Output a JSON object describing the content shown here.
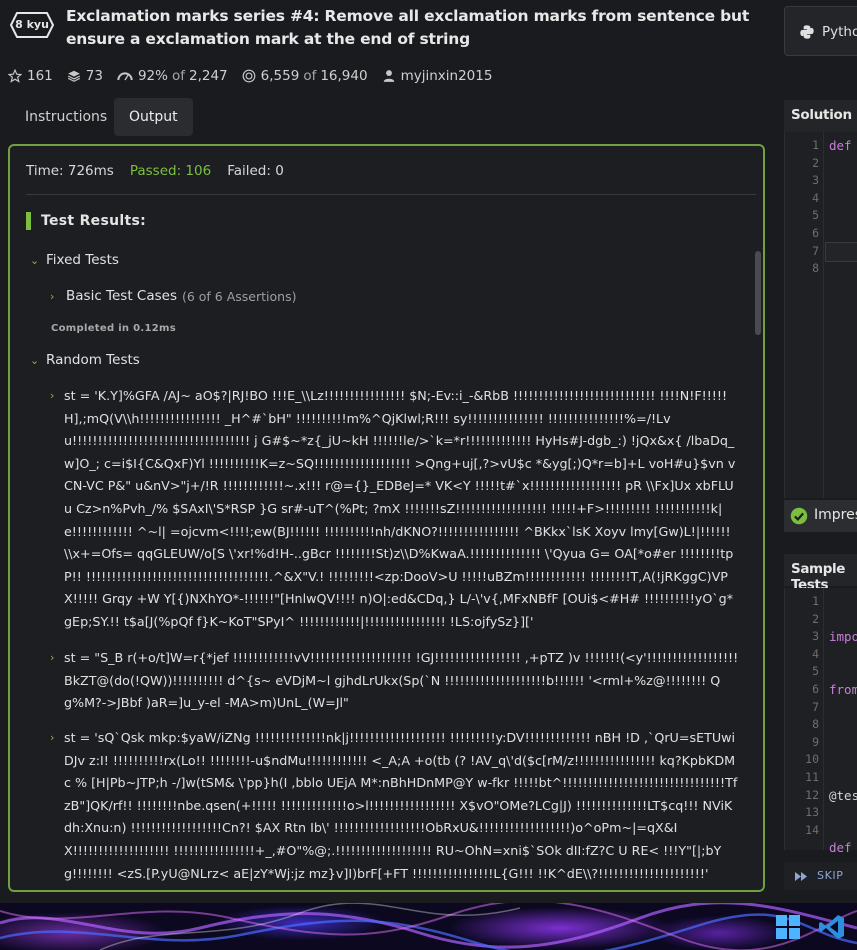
{
  "kata": {
    "rank": "8 kyu",
    "title": "Exclamation marks series #4: Remove all exclamation marks from sentence but ensure a exclamation mark at the end of string"
  },
  "stats": {
    "stars": "161",
    "collections": "73",
    "satisfaction": "92%",
    "of_word": "of",
    "votes": "2,247",
    "completed": "6,559",
    "attempts": "16,940",
    "author": "myjinxin2015"
  },
  "tabs": {
    "instructions": "Instructions",
    "output": "Output"
  },
  "output": {
    "time": "Time: 726ms",
    "passed": "Passed: 106",
    "failed": "Failed: 0",
    "test_results": "Test Results:",
    "fixed_tests": "Fixed Tests",
    "basic_cases": "Basic Test Cases",
    "basic_assertions": "(6 of 6 Assertions)",
    "completed": "Completed in 0.12ms",
    "random_tests": "Random Tests",
    "cases": [
      "st = 'K.Y]%GFA /AJ~ aO$?|RJ!BO !!!E_\\\\Lz!!!!!!!!!!!!!!!! $N;-Ev::i_-&RbB !!!!!!!!!!!!!!!!!!!!!!!!!!!! !!!!N!F!!!!!H],;mQ(V\\\\h!!!!!!!!!!!!!!!! _H^#`bH\" !!!!!!!!!!m%^QjKlwl;R!!! sy!!!!!!!!!!!!!!! !!!!!!!!!!!!!!!%=/!Lvu!!!!!!!!!!!!!!!!!!!!!!!!!!!!!!!!!!! j G#$~*z{_jU~kH !!!!!!le/>`k=*r!!!!!!!!!!!!! HyHs#J-dgb_:) !jQx&x{ /lbaDq_w]O_; c=i$I{C&QxF)Yl !!!!!!!!!!K=z~SQ!!!!!!!!!!!!!!!!!!! >Qng+uj[,?>vU$c *&yg[;)Q*r=b]+L voH#u}$vn vCN-VC P&\" u&nV>\"j+/!R !!!!!!!!!!!!~.x!!! r@={}_EDBeJ=* VK<Y !!!!!t#`x!!!!!!!!!!!!!!!!!! pR \\\\Fx]Ux xbFLUu Cz>n%Pvh_/% $SAxI\\'S*RSP }G sr#-uT^(%Pt; ?mX !!!!!!!sZ!!!!!!!!!!!!!!!!!!  !!!!!+F>!!!!!!!!! !!!!!!!!!!!k|e!!!!!!!!!!!! ^~l| =ojcvm<!!!!;ew(BJ!!!!!! !!!!!!!!!!nh/dKNO?!!!!!!!!!!!!!!!! ^BKkx`lsK Xoyv lmy[Gw)L!|!!!!!! \\\\x+=Ofs= qqGLEUW/o[S \\'xr!%d!H-..gBcr !!!!!!!!St)z\\\\D%KwaA.!!!!!!!!!!!!!! \\'Qyua G= OA[*o#er !!!!!!!!tpP!! !!!!!!!!!!!!!!!!!!!!!!!!!!!!!!!!!!!!.^&X\"V.! !!!!!!!!!<zp:DooV>U !!!!!uBZm!!!!!!!!!!!! !!!!!!!!T,A(!jRKggC)VPX!!!!! Grqy  +W Y[{)NXhYO*-!!!!!!\"[HnlwQV!!!! n)O|:ed&CDq,}  L/-\\'v{,MFxNBfF [OUi$<#H# !!!!!!!!!!yO`g*gEp;SY.!! t$a[J(%pQf f}K~KoT\"SPyI^ !!!!!!!!!!!!|!!!!!!!!!!!!!!!! !LS:ojfySz}]['",
      "st = \"S_B r(+o/t]W=r{*jef !!!!!!!!!!!!vV!!!!!!!!!!!!!!!!!!!! !GJ!!!!!!!!!!!!!!!!! ,+pTZ  )v !!!!!!!(<y'!!!!!!!!!!!!!!!!!!BkZT@(do(!QW))!!!!!!!!!! d^{s~ eVDjM~l gjhdLrUkx(Sp(`N !!!!!!!!!!!!!!!!!!!!b!!!!!! '<rml+%z@!!!!!!!! Qg%M?->JBbf )aR=]u_y-el -MA>m)UnL_(W=Jl\"",
      "st = 'sQ`Qsk mkp:$yaW/iZNg !!!!!!!!!!!!!!nk|j!!!!!!!!!!!!!!!!!!! !!!!!!!!!y:DV!!!!!!!!!!!!! nBH !D  ,`QrU=sETUwiDJv z:I! !!!!!!!!!!rx(Lo!! !!!!!!!!-u$ndMu!!!!!!!!!!!! <_A;A +o(tb (? !AV_q\\'d($c[rM/z!!!!!!!!!!!!!!!! kq?KpbKDMc % [H|Pb~JTP;h -/]w(tSM& \\'pp}h(I ,bblo UEjA M*:nBhHDnMP@Y w-fkr !!!!!bt^!!!!!!!!!!!!!!!!!!!!!!!!!!!!!!!!TfzB\"]QK/rf!! !!!!!!!!nbe.qsen(+!!!!! !!!!!!!!!!!!!o>l!!!!!!!!!!!!!!!!! X$vO\"OMe?LCg|J) !!!!!!!!!!!!!!LT$cq!!! NViKdh:Xnu:n) !!!!!!!!!!!!!!!!!!Cn?! $AX  Rtn Ib\\' !!!!!!!!!!!!!!!!!!ObRxU&!!!!!!!!!!!!!!!!!!)o^oPm~|=qX&IX!!!!!!!!!!!!!!!!!!! !!!!!!!!!!!!!!!!+_,#O\"%@;.!!!!!!!!!!!!!!!!!!! RU~OhN=xni$`SOk dII:fZ?C U RE< !!!Y\"[|;bYg!!!!!!!! <zS.[P.yU@NLrz< aE|zY*Wj:jz mz}v]I)brF[+FT !!!!!!!!!!!!!!!!L{G!!! !!K^dE\\\\?!!!!!!!!!!!!!!!!!!!!!'"
    ]
  },
  "language": "Python",
  "solution": {
    "title": "Solution",
    "line_numbers": [
      "1",
      "2",
      "3",
      "4",
      "5",
      "6",
      "7",
      "8"
    ],
    "code_line1": "def"
  },
  "impress": "Impress",
  "sample_tests": {
    "title": "Sample Tests",
    "line_numbers": [
      "1",
      "2",
      "3",
      "4",
      "5",
      "6",
      "7",
      "8",
      "9",
      "10",
      "11",
      "12",
      "13",
      "14"
    ],
    "code": [
      "impo",
      "from",
      "",
      "@tes",
      "def"
    ]
  },
  "skip": "SKIP",
  "colors": {
    "passed": "#7cbf3f",
    "border": "#6fa141",
    "keyword": "#c77fd8"
  }
}
